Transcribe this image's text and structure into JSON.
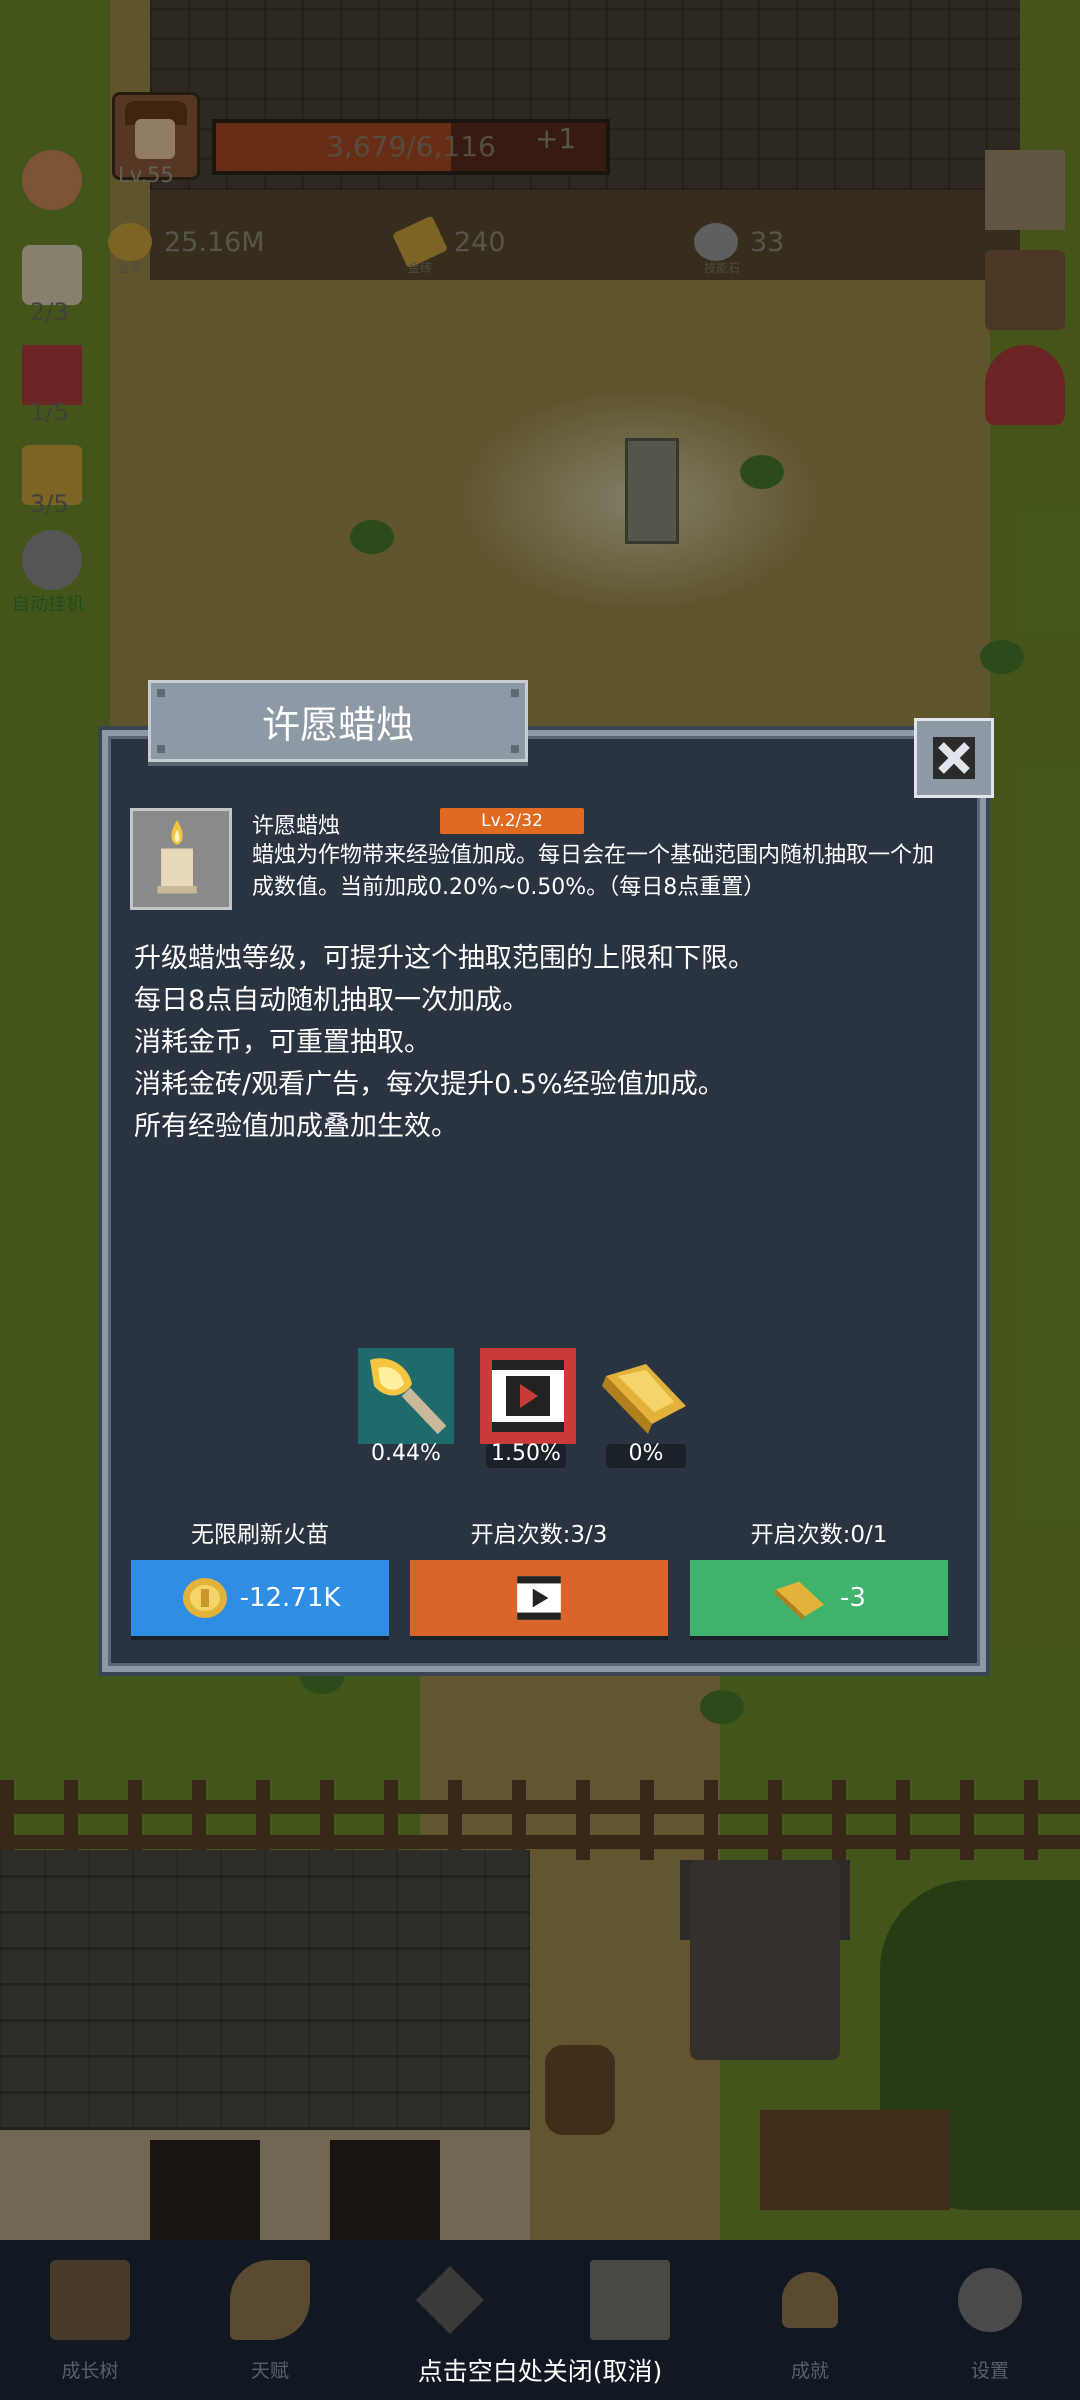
{
  "hud": {
    "level": "Lv.55",
    "xp_text": "3,679/6,116",
    "xp_fraction": 0.6015,
    "xp_bonus": "+1",
    "currencies": [
      {
        "value": "25.16M",
        "sub": "金币"
      },
      {
        "value": "240",
        "sub": "金砖"
      },
      {
        "value": "33",
        "sub": "技能石"
      }
    ],
    "side_counts": [
      "2/3",
      "1/5",
      "3/5"
    ],
    "auto_label": "自动挂机"
  },
  "dialog": {
    "title": "许愿蜡烛",
    "item_name": "许愿蜡烛",
    "item_level": "Lv.2/32",
    "description": "蜡烛为作物带来经验值加成。每日会在一个基础范围内随机抽取一个加成数值。当前加成0.20%~0.50%。（每日8点重置）",
    "rules": [
      "升级蜡烛等级，可提升这个抽取范围的上限和下限。",
      "每日8点自动随机抽取一次加成。",
      "消耗金币，可重置抽取。",
      "消耗金砖/观看广告，每次提升0.5%经验值加成。",
      "所有经验值加成叠加生效。"
    ],
    "bonuses": [
      {
        "icon": "torch-icon",
        "value": "0.44%"
      },
      {
        "icon": "video-icon",
        "value": "1.50%"
      },
      {
        "icon": "gold-brick-icon",
        "value": "0%"
      }
    ],
    "columns": [
      {
        "label": "无限刷新火苗",
        "button": "-12.71K",
        "color": "#2f8de4"
      },
      {
        "label": "开启次数:3/3",
        "button": "",
        "color": "#d9652a"
      },
      {
        "label": "开启次数:0/1",
        "button": "-3",
        "color": "#3fb26b"
      }
    ]
  },
  "nav": {
    "items": [
      "成长树",
      "天赋",
      "",
      "",
      "成就",
      "设置"
    ],
    "close_hint": "点击空白处关闭(取消)"
  }
}
